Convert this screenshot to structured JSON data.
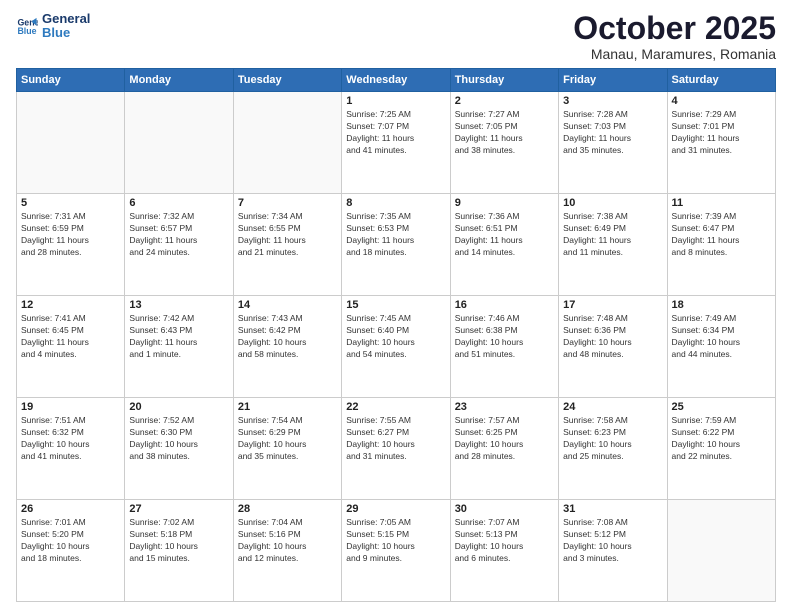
{
  "header": {
    "logo_line1": "General",
    "logo_line2": "Blue",
    "month": "October 2025",
    "location": "Manau, Maramures, Romania"
  },
  "weekdays": [
    "Sunday",
    "Monday",
    "Tuesday",
    "Wednesday",
    "Thursday",
    "Friday",
    "Saturday"
  ],
  "weeks": [
    [
      {
        "day": "",
        "info": ""
      },
      {
        "day": "",
        "info": ""
      },
      {
        "day": "",
        "info": ""
      },
      {
        "day": "1",
        "info": "Sunrise: 7:25 AM\nSunset: 7:07 PM\nDaylight: 11 hours\nand 41 minutes."
      },
      {
        "day": "2",
        "info": "Sunrise: 7:27 AM\nSunset: 7:05 PM\nDaylight: 11 hours\nand 38 minutes."
      },
      {
        "day": "3",
        "info": "Sunrise: 7:28 AM\nSunset: 7:03 PM\nDaylight: 11 hours\nand 35 minutes."
      },
      {
        "day": "4",
        "info": "Sunrise: 7:29 AM\nSunset: 7:01 PM\nDaylight: 11 hours\nand 31 minutes."
      }
    ],
    [
      {
        "day": "5",
        "info": "Sunrise: 7:31 AM\nSunset: 6:59 PM\nDaylight: 11 hours\nand 28 minutes."
      },
      {
        "day": "6",
        "info": "Sunrise: 7:32 AM\nSunset: 6:57 PM\nDaylight: 11 hours\nand 24 minutes."
      },
      {
        "day": "7",
        "info": "Sunrise: 7:34 AM\nSunset: 6:55 PM\nDaylight: 11 hours\nand 21 minutes."
      },
      {
        "day": "8",
        "info": "Sunrise: 7:35 AM\nSunset: 6:53 PM\nDaylight: 11 hours\nand 18 minutes."
      },
      {
        "day": "9",
        "info": "Sunrise: 7:36 AM\nSunset: 6:51 PM\nDaylight: 11 hours\nand 14 minutes."
      },
      {
        "day": "10",
        "info": "Sunrise: 7:38 AM\nSunset: 6:49 PM\nDaylight: 11 hours\nand 11 minutes."
      },
      {
        "day": "11",
        "info": "Sunrise: 7:39 AM\nSunset: 6:47 PM\nDaylight: 11 hours\nand 8 minutes."
      }
    ],
    [
      {
        "day": "12",
        "info": "Sunrise: 7:41 AM\nSunset: 6:45 PM\nDaylight: 11 hours\nand 4 minutes."
      },
      {
        "day": "13",
        "info": "Sunrise: 7:42 AM\nSunset: 6:43 PM\nDaylight: 11 hours\nand 1 minute."
      },
      {
        "day": "14",
        "info": "Sunrise: 7:43 AM\nSunset: 6:42 PM\nDaylight: 10 hours\nand 58 minutes."
      },
      {
        "day": "15",
        "info": "Sunrise: 7:45 AM\nSunset: 6:40 PM\nDaylight: 10 hours\nand 54 minutes."
      },
      {
        "day": "16",
        "info": "Sunrise: 7:46 AM\nSunset: 6:38 PM\nDaylight: 10 hours\nand 51 minutes."
      },
      {
        "day": "17",
        "info": "Sunrise: 7:48 AM\nSunset: 6:36 PM\nDaylight: 10 hours\nand 48 minutes."
      },
      {
        "day": "18",
        "info": "Sunrise: 7:49 AM\nSunset: 6:34 PM\nDaylight: 10 hours\nand 44 minutes."
      }
    ],
    [
      {
        "day": "19",
        "info": "Sunrise: 7:51 AM\nSunset: 6:32 PM\nDaylight: 10 hours\nand 41 minutes."
      },
      {
        "day": "20",
        "info": "Sunrise: 7:52 AM\nSunset: 6:30 PM\nDaylight: 10 hours\nand 38 minutes."
      },
      {
        "day": "21",
        "info": "Sunrise: 7:54 AM\nSunset: 6:29 PM\nDaylight: 10 hours\nand 35 minutes."
      },
      {
        "day": "22",
        "info": "Sunrise: 7:55 AM\nSunset: 6:27 PM\nDaylight: 10 hours\nand 31 minutes."
      },
      {
        "day": "23",
        "info": "Sunrise: 7:57 AM\nSunset: 6:25 PM\nDaylight: 10 hours\nand 28 minutes."
      },
      {
        "day": "24",
        "info": "Sunrise: 7:58 AM\nSunset: 6:23 PM\nDaylight: 10 hours\nand 25 minutes."
      },
      {
        "day": "25",
        "info": "Sunrise: 7:59 AM\nSunset: 6:22 PM\nDaylight: 10 hours\nand 22 minutes."
      }
    ],
    [
      {
        "day": "26",
        "info": "Sunrise: 7:01 AM\nSunset: 5:20 PM\nDaylight: 10 hours\nand 18 minutes."
      },
      {
        "day": "27",
        "info": "Sunrise: 7:02 AM\nSunset: 5:18 PM\nDaylight: 10 hours\nand 15 minutes."
      },
      {
        "day": "28",
        "info": "Sunrise: 7:04 AM\nSunset: 5:16 PM\nDaylight: 10 hours\nand 12 minutes."
      },
      {
        "day": "29",
        "info": "Sunrise: 7:05 AM\nSunset: 5:15 PM\nDaylight: 10 hours\nand 9 minutes."
      },
      {
        "day": "30",
        "info": "Sunrise: 7:07 AM\nSunset: 5:13 PM\nDaylight: 10 hours\nand 6 minutes."
      },
      {
        "day": "31",
        "info": "Sunrise: 7:08 AM\nSunset: 5:12 PM\nDaylight: 10 hours\nand 3 minutes."
      },
      {
        "day": "",
        "info": ""
      }
    ]
  ]
}
